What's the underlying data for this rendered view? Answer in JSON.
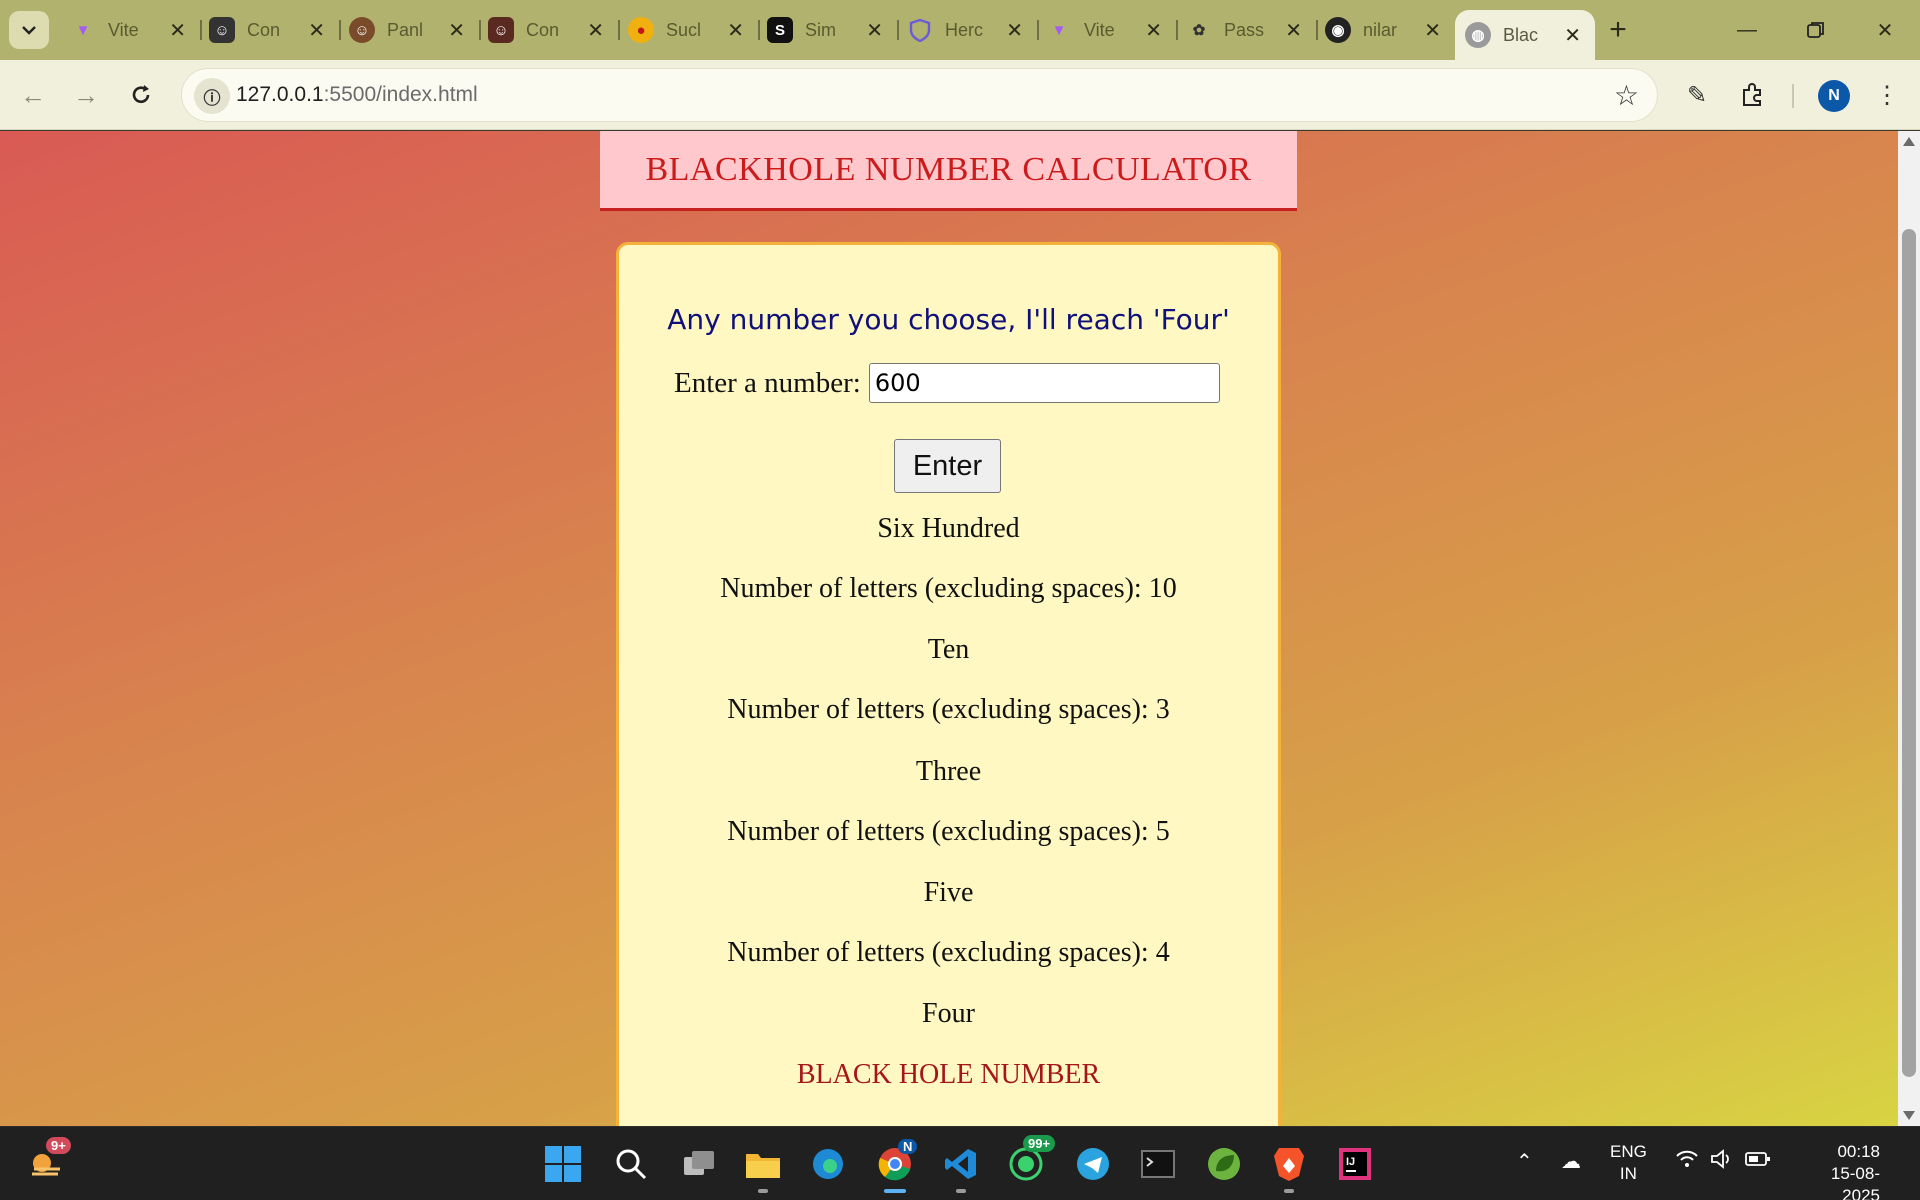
{
  "browser": {
    "tabs": [
      {
        "title": "Vite",
        "icon": "vite-icon",
        "active": false
      },
      {
        "title": "Con",
        "icon": "avatar-icon",
        "active": false
      },
      {
        "title": "Panl",
        "icon": "avatar-icon",
        "active": false
      },
      {
        "title": "Con",
        "icon": "avatar-icon",
        "active": false
      },
      {
        "title": "Sucl",
        "icon": "app-icon",
        "active": false
      },
      {
        "title": "Sim",
        "icon": "app-icon",
        "active": false
      },
      {
        "title": "Herc",
        "icon": "shield-icon",
        "active": false
      },
      {
        "title": "Vite",
        "icon": "vite-icon",
        "active": false
      },
      {
        "title": "Pass",
        "icon": "openai-icon",
        "active": false
      },
      {
        "title": "nilar",
        "icon": "github-icon",
        "active": false
      },
      {
        "title": "Blac",
        "icon": "globe-icon",
        "active": true
      }
    ],
    "url_host": "127.0.0.1",
    "url_path": ":5500/index.html",
    "profile_initial": "N"
  },
  "page": {
    "header_title": "BLACKHOLE NUMBER CALCULATOR",
    "tagline": "Any number you choose, I'll reach 'Four'",
    "input_label": "Enter a number:",
    "input_value": "600",
    "button_label": "Enter",
    "results": [
      "Six Hundred",
      "Number of letters (excluding spaces): 10",
      "Ten",
      "Number of letters (excluding spaces): 3",
      "Three",
      "Number of letters (excluding spaces): 5",
      "Five",
      "Number of letters (excluding spaces): 4",
      "Four"
    ],
    "final_label": "BLACK HOLE NUMBER",
    "colors": {
      "header_bg": "#ffc8cc",
      "header_text": "#cc1b1b",
      "card_bg": "#fff8c2",
      "card_border": "#f4b23a",
      "tagline_text": "#10107a",
      "final_text": "#a4161a"
    }
  },
  "taskbar": {
    "widgets_badge": "9+",
    "whatsapp_badge": "99+",
    "chrome_badge": "N",
    "lang_line1": "ENG",
    "lang_line2": "IN",
    "time": "00:18",
    "date": "15-08-2025"
  }
}
